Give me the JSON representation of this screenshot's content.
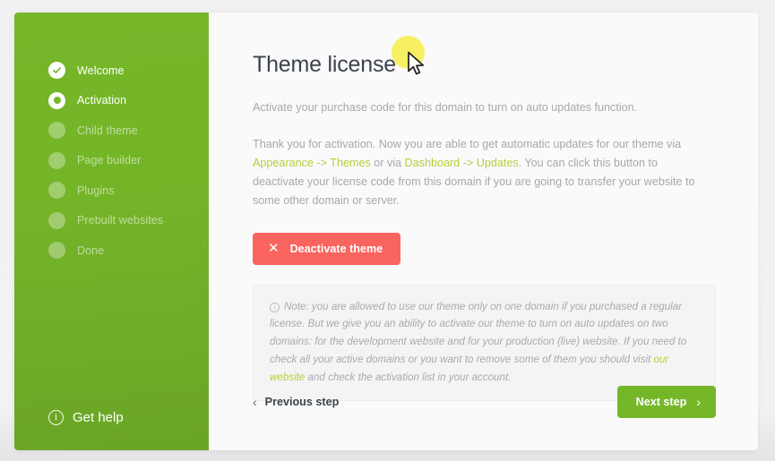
{
  "sidebar": {
    "steps": [
      {
        "label": "Welcome",
        "state": "done",
        "icon": "check-icon"
      },
      {
        "label": "Activation",
        "state": "active",
        "icon": "radio-active-icon"
      },
      {
        "label": "Child theme",
        "state": "pending",
        "icon": "dot-icon"
      },
      {
        "label": "Page builder",
        "state": "pending",
        "icon": "dot-icon"
      },
      {
        "label": "Plugins",
        "state": "pending",
        "icon": "dot-icon"
      },
      {
        "label": "Prebuilt websites",
        "state": "pending",
        "icon": "dot-icon"
      },
      {
        "label": "Done",
        "state": "pending",
        "icon": "dot-icon"
      }
    ],
    "get_help": {
      "label": "Get help",
      "icon": "info-circle-icon"
    },
    "colors": {
      "background_top": "#76b72a",
      "background_bottom": "#6aa526"
    }
  },
  "main": {
    "title": "Theme license",
    "lede": "Activate your purchase code for this domain to turn on auto updates function.",
    "body": {
      "part1": "Thank you for activation. Now you are able to get automatic updates for our theme via ",
      "link1": "Appearance",
      "arrow1": " -> ",
      "link2": "Themes",
      "part2": " or via ",
      "link3": "Dashboard",
      "arrow2": " -> ",
      "link4": "Updates",
      "part3": ". You can click this button to deactivate your license code from this domain if you are going to transfer your website to some other domain or server."
    },
    "deactivate_button": {
      "label": "Deactivate theme",
      "icon": "close-x-icon",
      "color": "#f9645f"
    },
    "note": {
      "icon": "info-circle-icon",
      "part1": "Note: you are allowed to use our theme only on one domain if you purchased a regular license. But we give you an ability to activate our theme to turn on auto updates on two domains: for the development website and for your production (live) website. If you need to check all your active domains or you want to remove some of them you should visit ",
      "link": "our website",
      "part2": " and check the activation list in your account."
    }
  },
  "footer": {
    "previous": {
      "label": "Previous step",
      "icon": "chevron-left-icon"
    },
    "next": {
      "label": "Next step",
      "icon": "chevron-right-icon",
      "color": "#76b72a"
    }
  },
  "cursor": {
    "icon": "mouse-pointer-icon",
    "halo_color": "#f6ef55"
  },
  "link_color": "#b4cf3c"
}
